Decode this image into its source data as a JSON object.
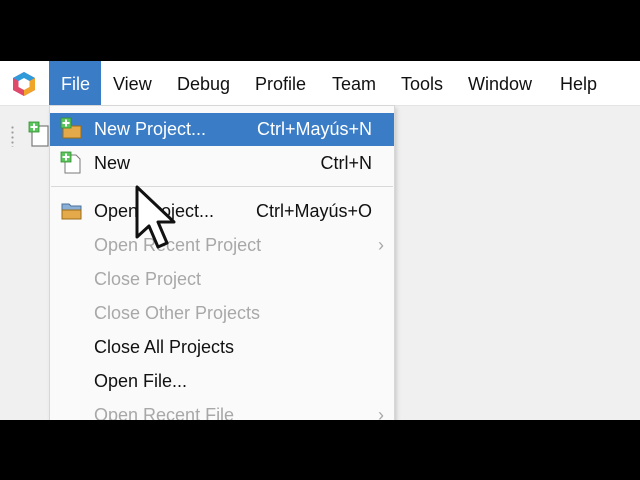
{
  "menubar": {
    "logo_icon": "netbeans-cube-icon",
    "items": [
      {
        "label": "File",
        "active": true
      },
      {
        "label": "View"
      },
      {
        "label": "Debug"
      },
      {
        "label": "Profile"
      },
      {
        "label": "Team"
      },
      {
        "label": "Tools"
      },
      {
        "label": "Window"
      },
      {
        "label": "Help"
      }
    ]
  },
  "toolbar": {
    "new_project_icon": "new-project-icon"
  },
  "file_menu": {
    "items": [
      {
        "label": "New Project...",
        "shortcut": "Ctrl+Mayús+N",
        "icon": "new-project-icon",
        "state": "highlighted"
      },
      {
        "label": "New",
        "shortcut": "Ctrl+N",
        "icon": "new-file-icon",
        "state": "enabled"
      },
      {
        "label": "Open Project...",
        "shortcut": "Ctrl+Mayús+O",
        "icon": "open-project-icon",
        "state": "enabled"
      },
      {
        "label": "Open Recent Project",
        "shortcut": "",
        "submenu": true,
        "state": "disabled"
      },
      {
        "label": "Close Project",
        "shortcut": "",
        "state": "disabled"
      },
      {
        "label": "Close Other Projects",
        "shortcut": "",
        "state": "disabled"
      },
      {
        "label": "Close All Projects",
        "shortcut": "",
        "state": "enabled"
      },
      {
        "label": "Open File...",
        "shortcut": "",
        "state": "enabled"
      },
      {
        "label": "Open Recent File",
        "shortcut": "",
        "submenu": true,
        "state": "disabled"
      }
    ],
    "submenu_glyph": "›"
  },
  "colors": {
    "highlight": "#3a7dc6",
    "disabled_text": "#a8a8a8",
    "menubar_bg": "#ffffff",
    "menu_bg": "#fafafa"
  },
  "cursor_icon": "mouse-pointer-icon"
}
